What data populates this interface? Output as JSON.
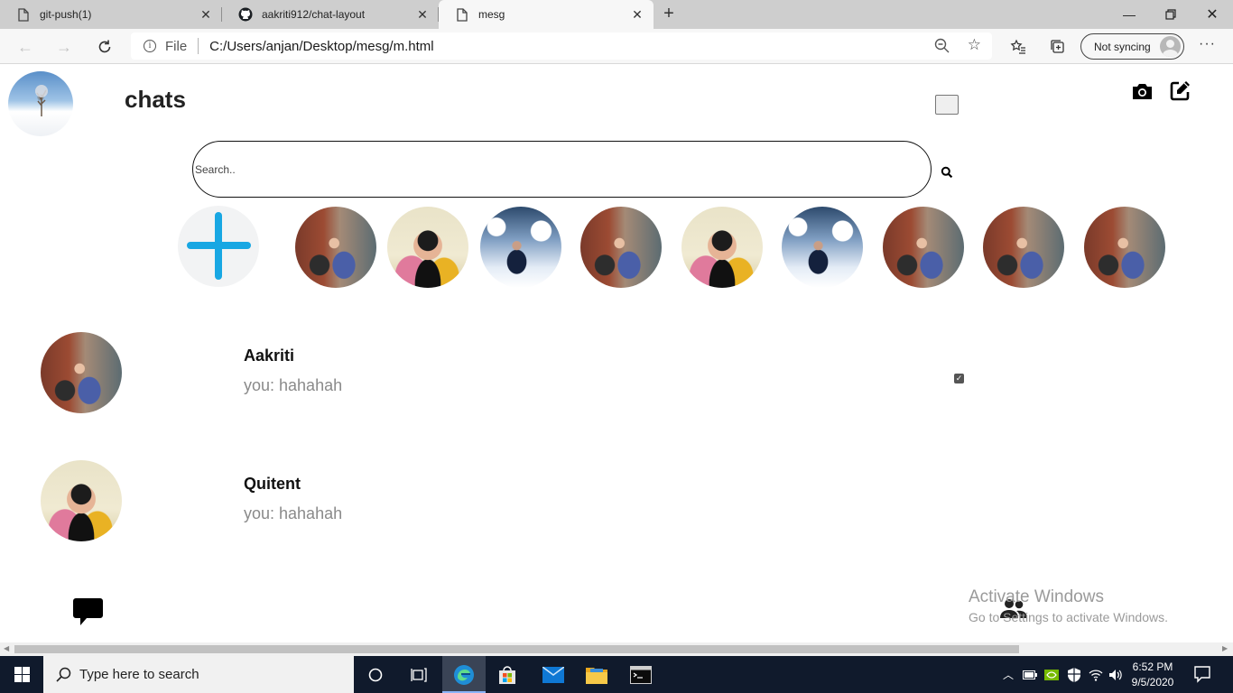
{
  "browser": {
    "tabs": [
      {
        "title": "git-push(1)"
      },
      {
        "title": "aakriti912/chat-layout"
      },
      {
        "title": "mesg"
      }
    ],
    "address": {
      "scheme_label": "File",
      "url": "C:/Users/anjan/Desktop/mesg/m.html"
    },
    "profile_button": "Not syncing"
  },
  "page": {
    "title": "chats",
    "search": {
      "placeholder": "Search.."
    },
    "stories": [
      {
        "photo": "aakriti"
      },
      {
        "photo": "quitent"
      },
      {
        "photo": "snow"
      },
      {
        "photo": "aakriti"
      },
      {
        "photo": "quitent"
      },
      {
        "photo": "snow"
      },
      {
        "photo": "aakriti"
      },
      {
        "photo": "aakriti"
      },
      {
        "photo": "aakriti"
      }
    ],
    "chats": [
      {
        "name": "Aakriti",
        "last_message": "you: hahahah",
        "photo": "aakriti",
        "checked": true
      },
      {
        "name": "Quitent",
        "last_message": "you: hahahah",
        "photo": "quitent",
        "checked": false
      }
    ],
    "bottom_nav": {
      "chat_icon": "chat-bubble-icon",
      "people_icon": "people-icon"
    }
  },
  "watermark": {
    "title": "Activate Windows",
    "subtitle": "Go to Settings to activate Windows."
  },
  "taskbar": {
    "search_placeholder": "Type here to search",
    "time": "6:52 PM",
    "date": "9/5/2020"
  },
  "colors": {
    "accent_plus": "#18a7e3",
    "taskbar": "#101a2c"
  }
}
